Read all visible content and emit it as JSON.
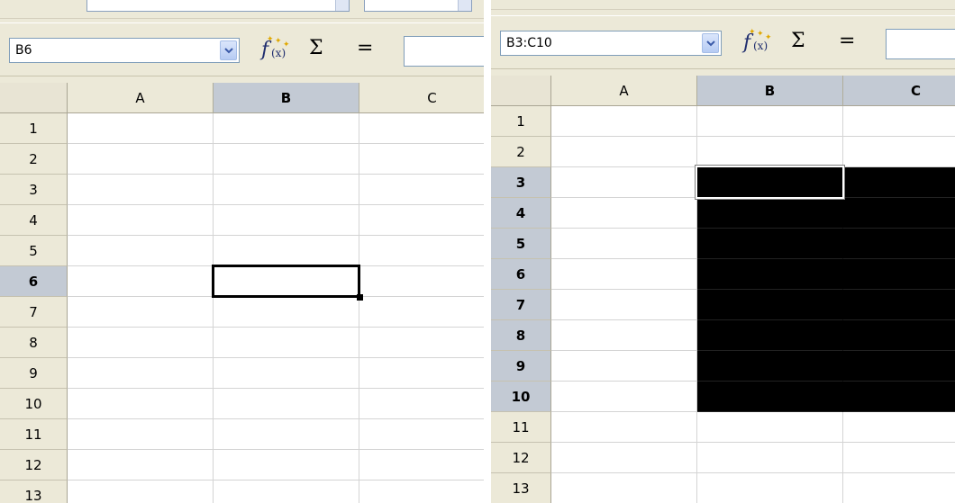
{
  "left": {
    "name_box": "B6",
    "toolbar_icons": [
      "function-wizard-icon",
      "sum-icon",
      "equals-icon"
    ],
    "sum_glyph": "Σ",
    "equals_glyph": "=",
    "columns": [
      "A",
      "B",
      "C"
    ],
    "selected_column": "B",
    "rows": [
      "1",
      "2",
      "3",
      "4",
      "5",
      "6",
      "7",
      "8",
      "9",
      "10",
      "11",
      "12",
      "13"
    ],
    "selected_row": "6",
    "active_cell": "B6"
  },
  "right": {
    "name_box": "B3:C10",
    "toolbar_icons": [
      "function-wizard-icon",
      "sum-icon",
      "equals-icon"
    ],
    "sum_glyph": "Σ",
    "equals_glyph": "=",
    "columns": [
      "A",
      "B",
      "C"
    ],
    "selected_columns": [
      "B",
      "C"
    ],
    "rows": [
      "1",
      "2",
      "3",
      "4",
      "5",
      "6",
      "7",
      "8",
      "9",
      "10",
      "11",
      "12",
      "13"
    ],
    "selected_rows": [
      "3",
      "4",
      "5",
      "6",
      "7",
      "8",
      "9",
      "10"
    ],
    "selected_range": "B3:C10",
    "active_cell": "B3"
  },
  "colors": {
    "toolbar_bg": "#ece9d8",
    "header_selected_bg": "#c3cad4",
    "selection_fill": "#000000",
    "gridline": "#d4d4d4"
  }
}
